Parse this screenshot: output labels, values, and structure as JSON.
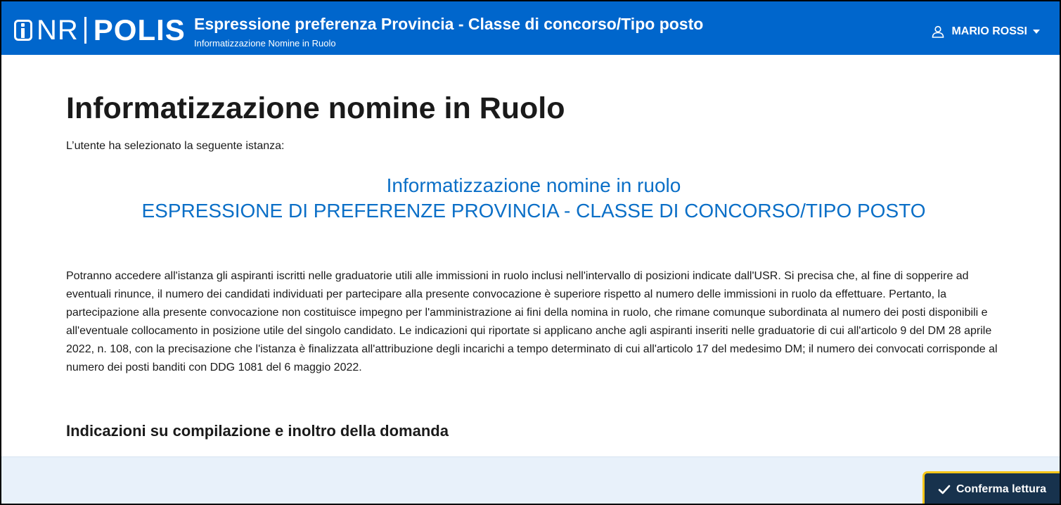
{
  "header": {
    "brand_nr": "NR",
    "brand_polis": "POLIS",
    "title": "Espressione preferenza Provincia - Classe di concorso/Tipo posto",
    "subtitle": "Informatizzazione Nomine in Ruolo",
    "user_name": "MARIO ROSSI",
    "background_color": "#0066cc"
  },
  "main": {
    "page_title": "Informatizzazione nomine in Ruolo",
    "intro": "L’utente ha selezionato la seguente istanza:",
    "instance_line1": "Informatizzazione nomine in ruolo",
    "instance_line2": "ESPRESSIONE DI PREFERENZE PROVINCIA - CLASSE DI CONCORSO/TIPO POSTO",
    "body": "Potranno accedere all'istanza gli aspiranti iscritti nelle graduatorie utili alle immissioni in ruolo inclusi nell'intervallo di posizioni indicate dall'USR. Si precisa che, al fine di sopperire ad eventuali rinunce, il numero dei candidati individuati per partecipare alla presente convocazione è superiore rispetto al numero delle immissioni in ruolo da effettuare. Pertanto, la partecipazione alla presente convocazione non costituisce impegno per l'amministrazione ai fini della nomina in ruolo, che rimane comunque subordinata al numero dei posti disponibili e all'eventuale collocamento in posizione utile del singolo candidato. Le indicazioni qui riportate si applicano anche agli aspiranti inseriti nelle graduatorie di cui all'articolo 9 del DM 28 aprile 2022, n. 108, con la precisazione che l'istanza è finalizzata all'attribuzione degli incarichi a tempo determinato di cui all'articolo 17 del medesimo DM; il numero dei convocati corrisponde al numero dei posti banditi con DDG 1081 del 6 maggio 2022.",
    "section_title": "Indicazioni su compilazione e inoltro della domanda"
  },
  "footer": {
    "confirm_label": "Conferma lettura",
    "button_color": "#17324d",
    "highlight_color": "#f5c518"
  },
  "icons": {
    "brand": "info-logo-icon",
    "user": "user-icon",
    "dropdown": "caret-down-icon",
    "confirm": "check-icon"
  }
}
